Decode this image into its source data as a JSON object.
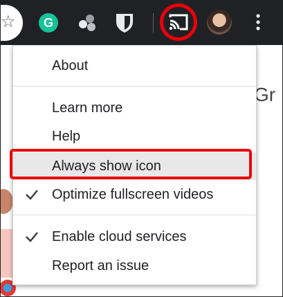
{
  "menu": {
    "items": [
      {
        "label": "About",
        "checked": false
      },
      {
        "label": "Learn more",
        "checked": false
      },
      {
        "label": "Help",
        "checked": false
      },
      {
        "label": "Always show icon",
        "checked": false,
        "highlighted": true
      },
      {
        "label": "Optimize fullscreen videos",
        "checked": true
      },
      {
        "label": "Enable cloud services",
        "checked": true
      },
      {
        "label": "Report an issue",
        "checked": false
      }
    ]
  },
  "toolbar": {
    "grammarly_letter": "G",
    "extensions": [
      "grammarly-icon",
      "extension-dots-icon",
      "bitwarden-icon",
      "cast-icon"
    ]
  },
  "page": {
    "partial_heading": "Gr"
  },
  "colors": {
    "toolbar_bg": "#202124",
    "grammarly_green": "#15c39a",
    "highlight_red": "#e8000b",
    "menu_hover": "#e8e8e8"
  }
}
